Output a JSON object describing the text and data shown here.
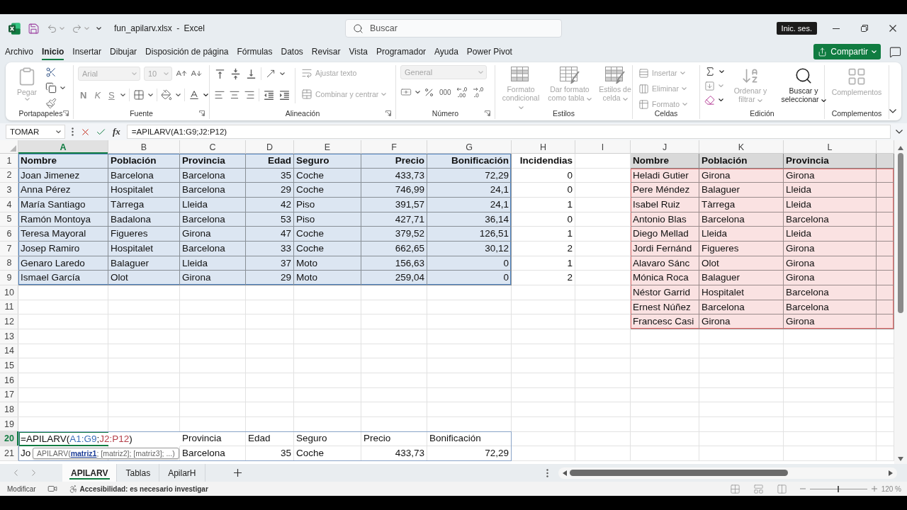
{
  "title_bar": {
    "document_title": "fun_apilarv.xlsx - Excel",
    "search": {
      "placeholder": "Buscar"
    },
    "sign_in": "Inic. ses."
  },
  "menu": {
    "tabs": [
      {
        "label": "Archivo",
        "selected": false
      },
      {
        "label": "Inicio",
        "selected": true
      },
      {
        "label": "Insertar",
        "selected": false
      },
      {
        "label": "Dibujar",
        "selected": false
      },
      {
        "label": "Disposición de página",
        "selected": false
      },
      {
        "label": "Fórmulas",
        "selected": false
      },
      {
        "label": "Datos",
        "selected": false
      },
      {
        "label": "Revisar",
        "selected": false
      },
      {
        "label": "Vista",
        "selected": false
      },
      {
        "label": "Programador",
        "selected": false
      },
      {
        "label": "Ayuda",
        "selected": false
      },
      {
        "label": "Power Pivot",
        "selected": false
      }
    ],
    "share": "Compartir"
  },
  "ribbon": {
    "groups": [
      {
        "kind": "clipboard",
        "label": "Portapapeles",
        "paste": {
          "label": "Pegar",
          "disabled": true
        }
      },
      {
        "kind": "font",
        "label": "Fuente",
        "font_name": {
          "value": "Arial",
          "disabled": true
        },
        "font_size": {
          "value": "10",
          "disabled": true
        },
        "styles": [
          {
            "kind": "bold",
            "label": "N",
            "disabled": true
          },
          {
            "kind": "italic",
            "label": "K",
            "disabled": true
          },
          {
            "kind": "underline",
            "label": "S",
            "disabled": true
          }
        ]
      },
      {
        "kind": "alignment",
        "label": "Alineación",
        "buttons": [
          {
            "label": "Ajustar texto",
            "disabled": true
          },
          {
            "label": "Combinar y centrar",
            "disabled": true
          }
        ]
      },
      {
        "kind": "number",
        "label": "Número",
        "format": {
          "value": "General",
          "disabled": true
        },
        "thousands": "000"
      },
      {
        "kind": "styles",
        "label": "Estilos",
        "buttons": [
          {
            "label": "Formato condicional",
            "disabled": true
          },
          {
            "label": "Dar formato como tabla",
            "disabled": true
          },
          {
            "label": "Estilos de celda",
            "disabled": true
          }
        ]
      },
      {
        "kind": "cells",
        "label": "Celdas",
        "buttons": [
          {
            "label": "Insertar",
            "disabled": true
          },
          {
            "label": "Eliminar",
            "disabled": true
          },
          {
            "label": "Formato",
            "disabled": true
          }
        ]
      },
      {
        "kind": "editing",
        "label": "Edición",
        "buttons": [
          {
            "label": "Ordenar y filtrar",
            "disabled": true
          },
          {
            "label": "Buscar y seleccionar",
            "disabled": false
          }
        ]
      },
      {
        "kind": "addins",
        "label": "Complementos",
        "buttons": [
          {
            "label": "Complementos",
            "disabled": true
          }
        ]
      }
    ]
  },
  "formula_bar": {
    "name_box": "TOMAR",
    "insert_function": "fx",
    "formula": "=APILARV(A1:G9;J2:P12)"
  },
  "sheet": {
    "columns": [
      {
        "letter": "A",
        "selected": true
      },
      {
        "letter": "B",
        "selected": false
      },
      {
        "letter": "C",
        "selected": false
      },
      {
        "letter": "D",
        "selected": false
      },
      {
        "letter": "E",
        "selected": false
      },
      {
        "letter": "F",
        "selected": false
      },
      {
        "letter": "G",
        "selected": false
      },
      {
        "letter": "H",
        "selected": false
      },
      {
        "letter": "I",
        "selected": false
      },
      {
        "letter": "J",
        "selected": false
      },
      {
        "letter": "K",
        "selected": false
      },
      {
        "letter": "L",
        "selected": false
      }
    ],
    "rows": [
      {
        "number": "1",
        "selected": false,
        "cells": [
          {
            "kind": "heading",
            "text": "Nombre",
            "color": "#dce6f2"
          },
          {
            "kind": "heading",
            "text": "Población",
            "color": "#dce6f2"
          },
          {
            "kind": "heading",
            "text": "Provincia",
            "color": "#dce6f2"
          },
          {
            "kind": "heading_right",
            "text": "Edad",
            "color": "#dce6f2"
          },
          {
            "kind": "heading",
            "text": "Seguro",
            "color": "#dce6f2"
          },
          {
            "kind": "heading_right",
            "text": "Precio",
            "color": "#dce6f2"
          },
          {
            "kind": "heading_right",
            "text": "Bonificación",
            "color": "#dce6f2"
          },
          {
            "kind": "heading_right",
            "text": "Incidendias"
          },
          null,
          {
            "kind": "heading",
            "text": "Nombre",
            "color": "#d9d9d9"
          },
          {
            "kind": "heading",
            "text": "Población",
            "color": "#d9d9d9"
          },
          {
            "kind": "heading",
            "text": "Provincia",
            "color": "#d9d9d9"
          },
          {
            "kind": "blank",
            "color": "#d9d9d9"
          }
        ]
      },
      {
        "number": "2",
        "selected": false,
        "cells": [
          {
            "kind": "text",
            "text": "Joan Jimenez",
            "color": "#dce6f2"
          },
          {
            "kind": "text",
            "text": "Barcelona",
            "color": "#dce6f2"
          },
          {
            "kind": "text",
            "text": "Barcelona",
            "color": "#dce6f2"
          },
          {
            "kind": "number",
            "text": "35",
            "color": "#dce6f2"
          },
          {
            "kind": "text",
            "text": "Coche",
            "color": "#dce6f2"
          },
          {
            "kind": "number",
            "text": "433,73",
            "color": "#dce6f2"
          },
          {
            "kind": "number",
            "text": "72,29",
            "color": "#dce6f2"
          },
          {
            "kind": "number",
            "text": "0"
          },
          null,
          {
            "kind": "text",
            "text": "Heladi Gutier",
            "color": "#fae2e2"
          },
          {
            "kind": "text",
            "text": "Girona",
            "color": "#fae2e2"
          },
          {
            "kind": "text",
            "text": "Girona",
            "color": "#fae2e2"
          },
          {
            "kind": "blank",
            "color": "#fae2e2"
          }
        ]
      },
      {
        "number": "3",
        "selected": false,
        "cells": [
          {
            "kind": "text",
            "text": "Anna Pérez",
            "color": "#dce6f2"
          },
          {
            "kind": "text",
            "text": "Hospitalet",
            "color": "#dce6f2"
          },
          {
            "kind": "text",
            "text": "Barcelona",
            "color": "#dce6f2"
          },
          {
            "kind": "number",
            "text": "29",
            "color": "#dce6f2"
          },
          {
            "kind": "text",
            "text": "Coche",
            "color": "#dce6f2"
          },
          {
            "kind": "number",
            "text": "746,99",
            "color": "#dce6f2"
          },
          {
            "kind": "number",
            "text": "24,1",
            "color": "#dce6f2"
          },
          {
            "kind": "number",
            "text": "0"
          },
          null,
          {
            "kind": "text",
            "text": "Pere Méndez",
            "color": "#fae2e2"
          },
          {
            "kind": "text",
            "text": "Balaguer",
            "color": "#fae2e2"
          },
          {
            "kind": "text",
            "text": "Lleida",
            "color": "#fae2e2"
          },
          {
            "kind": "blank",
            "color": "#fae2e2"
          }
        ]
      },
      {
        "number": "4",
        "selected": false,
        "cells": [
          {
            "kind": "text",
            "text": "María Santiago",
            "color": "#dce6f2"
          },
          {
            "kind": "text",
            "text": "Tàrrega",
            "color": "#dce6f2"
          },
          {
            "kind": "text",
            "text": "Lleida",
            "color": "#dce6f2"
          },
          {
            "kind": "number",
            "text": "42",
            "color": "#dce6f2"
          },
          {
            "kind": "text",
            "text": "Piso",
            "color": "#dce6f2"
          },
          {
            "kind": "number",
            "text": "391,57",
            "color": "#dce6f2"
          },
          {
            "kind": "number",
            "text": "24,1",
            "color": "#dce6f2"
          },
          {
            "kind": "number",
            "text": "1"
          },
          null,
          {
            "kind": "text",
            "text": "Isabel Ruiz",
            "color": "#fae2e2"
          },
          {
            "kind": "text",
            "text": "Tàrrega",
            "color": "#fae2e2"
          },
          {
            "kind": "text",
            "text": "Lleida",
            "color": "#fae2e2"
          },
          {
            "kind": "blank",
            "color": "#fae2e2"
          }
        ]
      },
      {
        "number": "5",
        "selected": false,
        "cells": [
          {
            "kind": "text",
            "text": "Ramón Montoya",
            "color": "#dce6f2"
          },
          {
            "kind": "text",
            "text": "Badalona",
            "color": "#dce6f2"
          },
          {
            "kind": "text",
            "text": "Barcelona",
            "color": "#dce6f2"
          },
          {
            "kind": "number",
            "text": "53",
            "color": "#dce6f2"
          },
          {
            "kind": "text",
            "text": "Piso",
            "color": "#dce6f2"
          },
          {
            "kind": "number",
            "text": "427,71",
            "color": "#dce6f2"
          },
          {
            "kind": "number",
            "text": "36,14",
            "color": "#dce6f2"
          },
          {
            "kind": "number",
            "text": "0"
          },
          null,
          {
            "kind": "text",
            "text": "Antonio Blas",
            "color": "#fae2e2"
          },
          {
            "kind": "text",
            "text": "Barcelona",
            "color": "#fae2e2"
          },
          {
            "kind": "text",
            "text": "Barcelona",
            "color": "#fae2e2"
          },
          {
            "kind": "blank",
            "color": "#fae2e2"
          }
        ]
      },
      {
        "number": "6",
        "selected": false,
        "cells": [
          {
            "kind": "text",
            "text": "Teresa Mayoral",
            "color": "#dce6f2"
          },
          {
            "kind": "text",
            "text": "Figueres",
            "color": "#dce6f2"
          },
          {
            "kind": "text",
            "text": "Girona",
            "color": "#dce6f2"
          },
          {
            "kind": "number",
            "text": "47",
            "color": "#dce6f2"
          },
          {
            "kind": "text",
            "text": "Coche",
            "color": "#dce6f2"
          },
          {
            "kind": "number",
            "text": "379,52",
            "color": "#dce6f2"
          },
          {
            "kind": "number",
            "text": "126,51",
            "color": "#dce6f2"
          },
          {
            "kind": "number",
            "text": "1"
          },
          null,
          {
            "kind": "text",
            "text": "Diego Mellad",
            "color": "#fae2e2"
          },
          {
            "kind": "text",
            "text": "Lleida",
            "color": "#fae2e2"
          },
          {
            "kind": "text",
            "text": "Lleida",
            "color": "#fae2e2"
          },
          {
            "kind": "blank",
            "color": "#fae2e2"
          }
        ]
      },
      {
        "number": "7",
        "selected": false,
        "cells": [
          {
            "kind": "text",
            "text": "Josep Ramiro",
            "color": "#dce6f2"
          },
          {
            "kind": "text",
            "text": "Hospitalet",
            "color": "#dce6f2"
          },
          {
            "kind": "text",
            "text": "Barcelona",
            "color": "#dce6f2"
          },
          {
            "kind": "number",
            "text": "33",
            "color": "#dce6f2"
          },
          {
            "kind": "text",
            "text": "Coche",
            "color": "#dce6f2"
          },
          {
            "kind": "number",
            "text": "662,65",
            "color": "#dce6f2"
          },
          {
            "kind": "number",
            "text": "30,12",
            "color": "#dce6f2"
          },
          {
            "kind": "number",
            "text": "2"
          },
          null,
          {
            "kind": "text",
            "text": "Jordi Fernánd",
            "color": "#fae2e2"
          },
          {
            "kind": "text",
            "text": "Figueres",
            "color": "#fae2e2"
          },
          {
            "kind": "text",
            "text": "Girona",
            "color": "#fae2e2"
          },
          {
            "kind": "blank",
            "color": "#fae2e2"
          }
        ]
      },
      {
        "number": "8",
        "selected": false,
        "cells": [
          {
            "kind": "text",
            "text": "Genaro Laredo",
            "color": "#dce6f2"
          },
          {
            "kind": "text",
            "text": "Balaguer",
            "color": "#dce6f2"
          },
          {
            "kind": "text",
            "text": "Lleida",
            "color": "#dce6f2"
          },
          {
            "kind": "number",
            "text": "37",
            "color": "#dce6f2"
          },
          {
            "kind": "text",
            "text": "Moto",
            "color": "#dce6f2"
          },
          {
            "kind": "number",
            "text": "156,63",
            "color": "#dce6f2"
          },
          {
            "kind": "number",
            "text": "0",
            "color": "#dce6f2"
          },
          {
            "kind": "number",
            "text": "1"
          },
          null,
          {
            "kind": "text",
            "text": "Alavaro Sánc",
            "color": "#fae2e2"
          },
          {
            "kind": "text",
            "text": "Olot",
            "color": "#fae2e2"
          },
          {
            "kind": "text",
            "text": "Girona",
            "color": "#fae2e2"
          },
          {
            "kind": "blank",
            "color": "#fae2e2"
          }
        ]
      },
      {
        "number": "9",
        "selected": false,
        "cells": [
          {
            "kind": "text",
            "text": "Ismael García",
            "color": "#dce6f2"
          },
          {
            "kind": "text",
            "text": "Olot",
            "color": "#dce6f2"
          },
          {
            "kind": "text",
            "text": "Girona",
            "color": "#dce6f2"
          },
          {
            "kind": "number",
            "text": "29",
            "color": "#dce6f2"
          },
          {
            "kind": "text",
            "text": "Moto",
            "color": "#dce6f2"
          },
          {
            "kind": "number",
            "text": "259,04",
            "color": "#dce6f2"
          },
          {
            "kind": "number",
            "text": "0",
            "color": "#dce6f2"
          },
          {
            "kind": "number",
            "text": "2"
          },
          null,
          {
            "kind": "text",
            "text": "Mónica Roca",
            "color": "#fae2e2"
          },
          {
            "kind": "text",
            "text": "Balaguer",
            "color": "#fae2e2"
          },
          {
            "kind": "text",
            "text": "Girona",
            "color": "#fae2e2"
          },
          {
            "kind": "blank",
            "color": "#fae2e2"
          }
        ]
      },
      {
        "number": "10",
        "selected": false,
        "cells": [
          null,
          null,
          null,
          null,
          null,
          null,
          null,
          null,
          null,
          {
            "kind": "text",
            "text": "Néstor Garrid",
            "color": "#fae2e2"
          },
          {
            "kind": "text",
            "text": "Hospitalet",
            "color": "#fae2e2"
          },
          {
            "kind": "text",
            "text": "Barcelona",
            "color": "#fae2e2"
          },
          {
            "kind": "blank",
            "color": "#fae2e2"
          }
        ]
      },
      {
        "number": "11",
        "selected": false,
        "cells": [
          null,
          null,
          null,
          null,
          null,
          null,
          null,
          null,
          null,
          {
            "kind": "text",
            "text": "Ernest Núñez",
            "color": "#fae2e2"
          },
          {
            "kind": "text",
            "text": "Barcelona",
            "color": "#fae2e2"
          },
          {
            "kind": "text",
            "text": "Barcelona",
            "color": "#fae2e2"
          },
          {
            "kind": "blank",
            "color": "#fae2e2"
          }
        ]
      },
      {
        "number": "12",
        "selected": false,
        "cells": [
          null,
          null,
          null,
          null,
          null,
          null,
          null,
          null,
          null,
          {
            "kind": "text",
            "text": "Francesc Casi",
            "color": "#fae2e2"
          },
          {
            "kind": "text",
            "text": "Girona",
            "color": "#fae2e2"
          },
          {
            "kind": "text",
            "text": "Girona",
            "color": "#fae2e2"
          },
          {
            "kind": "blank",
            "color": "#fae2e2"
          }
        ]
      },
      {
        "number": "13",
        "selected": false
      },
      {
        "number": "14",
        "selected": false
      },
      {
        "number": "15",
        "selected": false
      },
      {
        "number": "16",
        "selected": false
      },
      {
        "number": "17",
        "selected": false
      },
      {
        "number": "18",
        "selected": false
      },
      {
        "number": "19",
        "selected": false
      },
      {
        "number": "20",
        "selected": true,
        "cells": [
          {
            "kind": "formula",
            "parts": [
              {
                "text": "=APILARV("
              },
              {
                "text": "A1:G9",
                "color": "#3c6fb8"
              },
              {
                "text": ";"
              },
              {
                "text": "J2:P12",
                "color": "#b5404a"
              },
              {
                "text": ")"
              }
            ]
          },
          null,
          {
            "kind": "text",
            "text": "Provincia"
          },
          {
            "kind": "text",
            "text": "Edad"
          },
          {
            "kind": "text",
            "text": "Seguro"
          },
          {
            "kind": "text",
            "text": "Precio"
          },
          {
            "kind": "text",
            "text": "Bonificación"
          }
        ]
      },
      {
        "number": "21",
        "selected": false,
        "cells": [
          {
            "kind": "text",
            "text": "Jo"
          },
          null,
          {
            "kind": "text",
            "text": "Barcelona"
          },
          {
            "kind": "number",
            "text": "35"
          },
          {
            "kind": "text",
            "text": "Coche"
          },
          {
            "kind": "number",
            "text": "433,73"
          },
          {
            "kind": "number",
            "text": "72,29"
          }
        ]
      }
    ],
    "tooltip": "APILARV(**matriz1**; [matriz2]; [matriz3]; ...)"
  },
  "sheet_tabs": [
    {
      "label": "APILARV",
      "selected": true
    },
    {
      "label": "Tablas",
      "selected": false
    },
    {
      "label": "ApilarH",
      "selected": false
    }
  ],
  "status_bar": {
    "mode": "Modificar",
    "accessibility": "Accesibilidad: es necesario investigar",
    "zoom": {
      "level": 0.5,
      "reading": "120 %"
    }
  }
}
